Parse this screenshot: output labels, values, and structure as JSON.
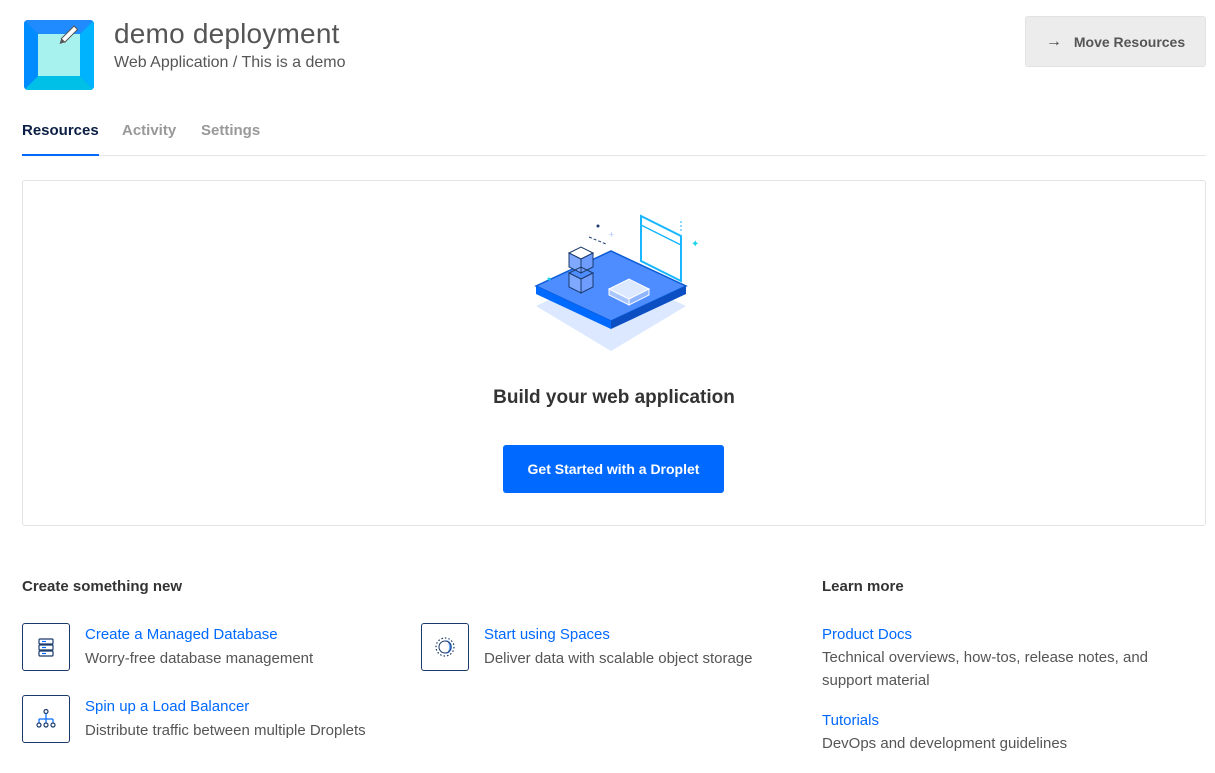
{
  "project": {
    "title": "demo deployment",
    "subtitle": "Web Application / This is a demo",
    "icon": "project-edit-icon"
  },
  "actions": {
    "move_label": "Move Resources",
    "move_icon": "arrow-right-icon"
  },
  "tabs": [
    {
      "label": "Resources",
      "active": true
    },
    {
      "label": "Activity",
      "active": false
    },
    {
      "label": "Settings",
      "active": false
    }
  ],
  "hero": {
    "title": "Build your web application",
    "cta_label": "Get Started with a Droplet"
  },
  "create": {
    "heading": "Create something new",
    "items": [
      {
        "title": "Create a Managed Database",
        "desc": "Worry-free database management",
        "icon": "database-icon"
      },
      {
        "title": "Start using Spaces",
        "desc": "Deliver data with scalable object storage",
        "icon": "spaces-icon"
      },
      {
        "title": "Spin up a Load Balancer",
        "desc": "Distribute traffic between multiple Droplets",
        "icon": "load-balancer-icon"
      }
    ]
  },
  "learn": {
    "heading": "Learn more",
    "items": [
      {
        "title": "Product Docs",
        "desc_line1": "Technical overviews, how-tos, release notes, and",
        "desc_line2": "support material"
      },
      {
        "title": "Tutorials",
        "desc_line1": "DevOps and development guidelines"
      }
    ]
  },
  "colors": {
    "accent": "#0069ff",
    "navy": "#0b1f44"
  }
}
